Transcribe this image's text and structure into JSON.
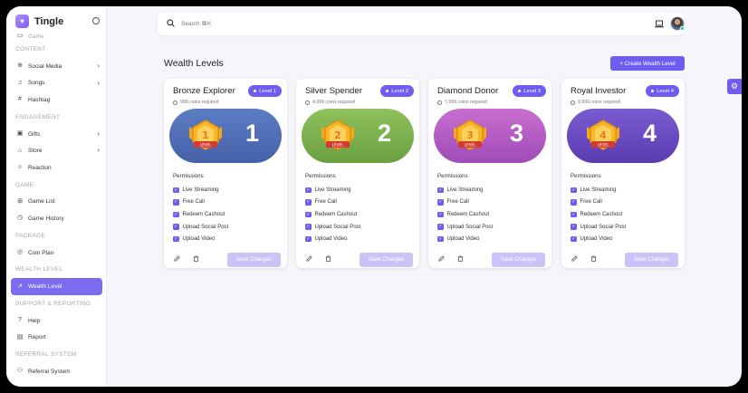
{
  "app": {
    "name": "Tingle"
  },
  "sidebar": {
    "partial_item": "Game",
    "sections": [
      {
        "title": "CONTENT",
        "items": [
          {
            "label": "Social Media",
            "icon": "share-icon",
            "chevron": true
          },
          {
            "label": "Songs",
            "icon": "music-icon",
            "chevron": true
          },
          {
            "label": "Hashtag",
            "icon": "hash-icon",
            "chevron": false
          }
        ]
      },
      {
        "title": "ENGAGEMENT",
        "items": [
          {
            "label": "Gifts",
            "icon": "gift-icon",
            "chevron": true
          },
          {
            "label": "Store",
            "icon": "store-icon",
            "chevron": true
          },
          {
            "label": "Reaction",
            "icon": "smile-icon",
            "chevron": false
          }
        ]
      },
      {
        "title": "GAME",
        "items": [
          {
            "label": "Game List",
            "icon": "gamepad-icon",
            "chevron": false
          },
          {
            "label": "Game History",
            "icon": "history-icon",
            "chevron": false
          }
        ]
      },
      {
        "title": "PACKAGE",
        "items": [
          {
            "label": "Coin Plan",
            "icon": "coin-icon",
            "chevron": false
          }
        ]
      },
      {
        "title": "WEALTH LEVEL",
        "items": [
          {
            "label": "Wealth Level",
            "icon": "trending-icon",
            "chevron": false,
            "active": true
          }
        ]
      },
      {
        "title": "SUPPORT & REPORTING",
        "items": [
          {
            "label": "Help",
            "icon": "help-icon",
            "chevron": false
          },
          {
            "label": "Report",
            "icon": "report-icon",
            "chevron": false
          }
        ]
      },
      {
        "title": "REFERRAL SYSTEM",
        "items": [
          {
            "label": "Referral System",
            "icon": "users-icon",
            "chevron": false
          }
        ]
      }
    ]
  },
  "topbar": {
    "search_placeholder": "Search ⌘K"
  },
  "main": {
    "title": "Wealth Levels",
    "create_label": "+ Create Wealth Level"
  },
  "permissions_title": "Permissions",
  "save_label": "Save Changes",
  "cards": [
    {
      "name": "Bronze Explorer",
      "level": "Level 1",
      "coins": "999 coins required",
      "number": "1",
      "colors": [
        "#5b7cc4",
        "#4660a8"
      ],
      "permissions": [
        "Live Streaming",
        "Free Call",
        "Redeem Cashout",
        "Upload Social Post",
        "Upload Video"
      ]
    },
    {
      "name": "Silver Spender",
      "level": "Level 2",
      "coins": "4,999 coins required",
      "number": "2",
      "colors": [
        "#8fc15c",
        "#6aa040"
      ],
      "permissions": [
        "Live Streaming",
        "Free Call",
        "Redeem Cashout",
        "Upload Social Post",
        "Upload Video"
      ]
    },
    {
      "name": "Diamond Donor",
      "level": "Level 3",
      "coins": "7,999 coins required",
      "number": "3",
      "colors": [
        "#c86ed0",
        "#a04bb8"
      ],
      "permissions": [
        "Live Streaming",
        "Free Call",
        "Redeem Cashout",
        "Upload Social Post",
        "Upload Video"
      ]
    },
    {
      "name": "Royal Investor",
      "level": "Level 4",
      "coins": "9,999 coins required",
      "number": "4",
      "colors": [
        "#7a5bd0",
        "#5a3cb0"
      ],
      "permissions": [
        "Live Streaming",
        "Free Call",
        "Redeem Cashout",
        "Upload Social Post",
        "Upload Video"
      ]
    }
  ],
  "colors": {
    "accent": "#6f5df0",
    "active_nav": "#7c6cf0",
    "disabled_button": "#c9c3f8"
  }
}
